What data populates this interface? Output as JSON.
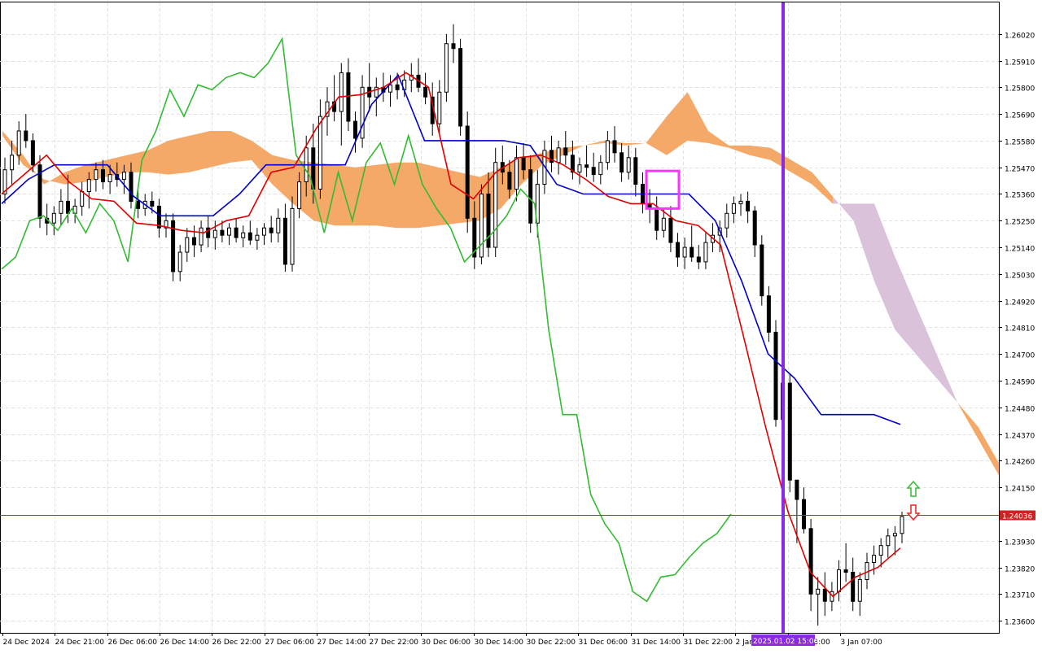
{
  "chart_data": {
    "type": "candlestick",
    "indicator": "Ichimoku Kinko Hyo",
    "grid": true,
    "ylim": [
      1.2355,
      1.2615
    ],
    "price_ticks": [
      "1.26020",
      "1.25910",
      "1.25800",
      "1.25690",
      "1.25580",
      "1.25470",
      "1.25360",
      "1.25250",
      "1.25140",
      "1.25030",
      "1.24920",
      "1.24810",
      "1.24700",
      "1.24590",
      "1.24480",
      "1.24370",
      "1.24260",
      "1.24150",
      "1.23930",
      "1.23820",
      "1.23710",
      "1.23600"
    ],
    "current_price": "1.24036",
    "current_price_value": 1.24036,
    "time_labels": [
      "24 Dec 2024",
      "24 Dec 21:00",
      "26 Dec 06:00",
      "26 Dec 14:00",
      "26 Dec 22:00",
      "27 Dec 06:00",
      "27 Dec 14:00",
      "27 Dec 22:00",
      "30 Dec 06:00",
      "30 Dec 14:00",
      "30 Dec 22:00",
      "31 Dec 06:00",
      "31 Dec 14:00",
      "31 Dec 22:00",
      "2 Jan",
      "2 Jan 23:00",
      "3 Jan 07:00"
    ],
    "highlight_time_label": "2025.01.02 15:00",
    "candles": [
      [
        1.2536,
        1.2551,
        1.2532,
        1.2546
      ],
      [
        1.2546,
        1.2558,
        1.254,
        1.2552
      ],
      [
        1.2552,
        1.2566,
        1.2548,
        1.2562
      ],
      [
        1.2562,
        1.2569,
        1.2555,
        1.2558
      ],
      [
        1.2558,
        1.2561,
        1.2545,
        1.2548
      ],
      [
        1.2548,
        1.2552,
        1.2522,
        1.2526
      ],
      [
        1.2526,
        1.2532,
        1.2519,
        1.2524
      ],
      [
        1.2524,
        1.2531,
        1.2519,
        1.2528
      ],
      [
        1.2528,
        1.2538,
        1.2523,
        1.2533
      ],
      [
        1.2533,
        1.2544,
        1.2524,
        1.2528
      ],
      [
        1.2528,
        1.2534,
        1.2524,
        1.2531
      ],
      [
        1.2531,
        1.2541,
        1.2527,
        1.2537
      ],
      [
        1.2537,
        1.2545,
        1.253,
        1.2542
      ],
      [
        1.2542,
        1.2549,
        1.2537,
        1.2546
      ],
      [
        1.2546,
        1.255,
        1.2538,
        1.2541
      ],
      [
        1.2541,
        1.2548,
        1.2536,
        1.2544
      ],
      [
        1.2544,
        1.2549,
        1.2539,
        1.2542
      ],
      [
        1.2542,
        1.2548,
        1.2536,
        1.2545
      ],
      [
        1.2545,
        1.2549,
        1.253,
        1.2533
      ],
      [
        1.2533,
        1.2538,
        1.2526,
        1.253
      ],
      [
        1.253,
        1.2536,
        1.2527,
        1.2533
      ],
      [
        1.2533,
        1.2537,
        1.2528,
        1.2531
      ],
      [
        1.2531,
        1.2534,
        1.2518,
        1.2522
      ],
      [
        1.2522,
        1.2528,
        1.2518,
        1.2525
      ],
      [
        1.2525,
        1.2528,
        1.25,
        1.2504
      ],
      [
        1.2504,
        1.2515,
        1.25,
        1.2512
      ],
      [
        1.2512,
        1.2522,
        1.2508,
        1.2518
      ],
      [
        1.2518,
        1.2523,
        1.251,
        1.2515
      ],
      [
        1.2515,
        1.2525,
        1.2512,
        1.2522
      ],
      [
        1.2522,
        1.2527,
        1.2514,
        1.2518
      ],
      [
        1.2518,
        1.2525,
        1.2513,
        1.2521
      ],
      [
        1.2521,
        1.2525,
        1.2516,
        1.2519
      ],
      [
        1.2519,
        1.2524,
        1.2515,
        1.2522
      ],
      [
        1.2522,
        1.2526,
        1.2516,
        1.2518
      ],
      [
        1.2518,
        1.2523,
        1.2514,
        1.252
      ],
      [
        1.252,
        1.2525,
        1.2515,
        1.2517
      ],
      [
        1.2517,
        1.2522,
        1.2513,
        1.2519
      ],
      [
        1.2519,
        1.2524,
        1.2515,
        1.2522
      ],
      [
        1.2522,
        1.2527,
        1.2516,
        1.252
      ],
      [
        1.252,
        1.253,
        1.2516,
        1.2526
      ],
      [
        1.2526,
        1.2532,
        1.2504,
        1.2507
      ],
      [
        1.2507,
        1.2535,
        1.2504,
        1.253
      ],
      [
        1.253,
        1.2545,
        1.2526,
        1.2541
      ],
      [
        1.2541,
        1.256,
        1.2535,
        1.2555
      ],
      [
        1.2555,
        1.2565,
        1.2532,
        1.2538
      ],
      [
        1.2538,
        1.2575,
        1.2534,
        1.2568
      ],
      [
        1.2568,
        1.258,
        1.256,
        1.2574
      ],
      [
        1.2574,
        1.2585,
        1.2566,
        1.257
      ],
      [
        1.257,
        1.259,
        1.2556,
        1.2586
      ],
      [
        1.2586,
        1.2592,
        1.2562,
        1.2566
      ],
      [
        1.2566,
        1.257,
        1.2553,
        1.2559
      ],
      [
        1.2559,
        1.2585,
        1.2555,
        1.258
      ],
      [
        1.258,
        1.259,
        1.257,
        1.2576
      ],
      [
        1.2576,
        1.2584,
        1.2568,
        1.258
      ],
      [
        1.258,
        1.2586,
        1.2574,
        1.2578
      ],
      [
        1.2578,
        1.2585,
        1.2572,
        1.2581
      ],
      [
        1.2581,
        1.2586,
        1.2575,
        1.2579
      ],
      [
        1.2579,
        1.2587,
        1.2576,
        1.2583
      ],
      [
        1.2583,
        1.259,
        1.2578,
        1.2585
      ],
      [
        1.2585,
        1.2592,
        1.2578,
        1.258
      ],
      [
        1.258,
        1.2586,
        1.2573,
        1.2576
      ],
      [
        1.2576,
        1.2582,
        1.256,
        1.2565
      ],
      [
        1.2565,
        1.2583,
        1.2561,
        1.2578
      ],
      [
        1.2578,
        1.2602,
        1.2574,
        1.2598
      ],
      [
        1.2598,
        1.2606,
        1.259,
        1.2596
      ],
      [
        1.2596,
        1.26,
        1.256,
        1.2564
      ],
      [
        1.2564,
        1.257,
        1.252,
        1.2526
      ],
      [
        1.2526,
        1.2533,
        1.2505,
        1.251
      ],
      [
        1.251,
        1.254,
        1.2507,
        1.2536
      ],
      [
        1.2536,
        1.2545,
        1.251,
        1.2514
      ],
      [
        1.2514,
        1.2555,
        1.251,
        1.2549
      ],
      [
        1.2549,
        1.2556,
        1.254,
        1.2545
      ],
      [
        1.2545,
        1.255,
        1.2534,
        1.2538
      ],
      [
        1.2538,
        1.2556,
        1.2533,
        1.2551
      ],
      [
        1.2551,
        1.2557,
        1.2542,
        1.2546
      ],
      [
        1.2546,
        1.2552,
        1.252,
        1.2524
      ],
      [
        1.2524,
        1.2546,
        1.2518,
        1.254
      ],
      [
        1.254,
        1.2558,
        1.2536,
        1.2554
      ],
      [
        1.2554,
        1.256,
        1.2545,
        1.2549
      ],
      [
        1.2549,
        1.2558,
        1.2544,
        1.2555
      ],
      [
        1.2555,
        1.2562,
        1.2548,
        1.2552
      ],
      [
        1.2552,
        1.2558,
        1.2542,
        1.2545
      ],
      [
        1.2545,
        1.2551,
        1.254,
        1.2548
      ],
      [
        1.2548,
        1.2556,
        1.2543,
        1.2547
      ],
      [
        1.2547,
        1.2553,
        1.2541,
        1.2544
      ],
      [
        1.2544,
        1.2552,
        1.254,
        1.2549
      ],
      [
        1.2549,
        1.2562,
        1.2546,
        1.2558
      ],
      [
        1.2558,
        1.2564,
        1.2549,
        1.2553
      ],
      [
        1.2553,
        1.2557,
        1.2541,
        1.2545
      ],
      [
        1.2545,
        1.2556,
        1.2542,
        1.2551
      ],
      [
        1.2551,
        1.2555,
        1.2535,
        1.254
      ],
      [
        1.254,
        1.2545,
        1.2528,
        1.2532
      ],
      [
        1.2532,
        1.2538,
        1.2524,
        1.253
      ],
      [
        1.253,
        1.2535,
        1.2517,
        1.2521
      ],
      [
        1.2521,
        1.253,
        1.2518,
        1.2526
      ],
      [
        1.2526,
        1.2531,
        1.2512,
        1.2516
      ],
      [
        1.2516,
        1.252,
        1.2506,
        1.251
      ],
      [
        1.251,
        1.2518,
        1.2505,
        1.2514
      ],
      [
        1.2514,
        1.2523,
        1.2508,
        1.251
      ],
      [
        1.251,
        1.2515,
        1.2505,
        1.2508
      ],
      [
        1.2508,
        1.252,
        1.2505,
        1.2516
      ],
      [
        1.2516,
        1.2524,
        1.2512,
        1.2519
      ],
      [
        1.2519,
        1.2525,
        1.2512,
        1.2522
      ],
      [
        1.2522,
        1.2532,
        1.2518,
        1.2528
      ],
      [
        1.2528,
        1.2535,
        1.2524,
        1.2532
      ],
      [
        1.2532,
        1.2536,
        1.2527,
        1.2533
      ],
      [
        1.2533,
        1.2537,
        1.2524,
        1.2529
      ],
      [
        1.2529,
        1.2531,
        1.251,
        1.2515
      ],
      [
        1.2515,
        1.2519,
        1.249,
        1.2494
      ],
      [
        1.2494,
        1.2498,
        1.2475,
        1.2479
      ],
      [
        1.2479,
        1.2484,
        1.244,
        1.2443
      ],
      [
        1.2443,
        1.2462,
        1.2436,
        1.2458
      ],
      [
        1.2458,
        1.2462,
        1.2413,
        1.2418
      ],
      [
        1.2418,
        1.2412,
        1.2392,
        1.241
      ],
      [
        1.241,
        1.2415,
        1.2396,
        1.2398
      ],
      [
        1.2398,
        1.2402,
        1.2364,
        1.2371
      ],
      [
        1.2371,
        1.2378,
        1.2358,
        1.2373
      ],
      [
        1.2373,
        1.238,
        1.2362,
        1.2368
      ],
      [
        1.2368,
        1.2376,
        1.2364,
        1.2372
      ],
      [
        1.2372,
        1.2385,
        1.2368,
        1.2381
      ],
      [
        1.2381,
        1.2392,
        1.2376,
        1.238
      ],
      [
        1.238,
        1.2386,
        1.2364,
        1.2368
      ],
      [
        1.2368,
        1.238,
        1.2362,
        1.2377
      ],
      [
        1.2377,
        1.2388,
        1.2373,
        1.2384
      ],
      [
        1.2384,
        1.2391,
        1.2379,
        1.2387
      ],
      [
        1.2387,
        1.2394,
        1.2382,
        1.2391
      ],
      [
        1.2391,
        1.2398,
        1.2386,
        1.2395
      ],
      [
        1.2395,
        1.2399,
        1.2387,
        1.2396
      ],
      [
        1.2396,
        1.2405,
        1.2392,
        1.2403
      ]
    ],
    "tenkan_sen": [
      [
        1.2536,
        1.2544
      ],
      [
        1.2546,
        1.2552
      ],
      [
        1.2552,
        1.2541
      ],
      [
        1.2541,
        1.2534
      ],
      [
        1.2534,
        1.2533
      ],
      [
        1.2533,
        1.2524
      ],
      [
        1.2524,
        1.2523
      ],
      [
        1.2523,
        1.2521
      ],
      [
        1.2521,
        1.252
      ],
      [
        1.252,
        1.2525
      ],
      [
        1.2525,
        1.2527
      ],
      [
        1.2527,
        1.2545
      ],
      [
        1.2545,
        1.2547
      ],
      [
        1.2547,
        1.2563
      ],
      [
        1.2563,
        1.2576
      ],
      [
        1.2576,
        1.2577
      ],
      [
        1.2577,
        1.258
      ],
      [
        1.258,
        1.2586
      ],
      [
        1.2586,
        1.258
      ],
      [
        1.258,
        1.254
      ],
      [
        1.254,
        1.2534
      ],
      [
        1.2534,
        1.2545
      ],
      [
        1.2545,
        1.2551
      ],
      [
        1.2551,
        1.2552
      ],
      [
        1.2552,
        1.2548
      ],
      [
        1.2548,
        1.2542
      ],
      [
        1.2542,
        1.2535
      ],
      [
        1.2535,
        1.2532
      ],
      [
        1.2532,
        1.2532
      ],
      [
        1.2532,
        1.2525
      ],
      [
        1.2525,
        1.2523
      ],
      [
        1.2523,
        1.2515
      ],
      [
        1.2515,
        1.2478
      ],
      [
        1.2478,
        1.244
      ],
      [
        1.244,
        1.2405
      ],
      [
        1.2405,
        1.238
      ],
      [
        1.238,
        1.237
      ],
      [
        1.237,
        1.2378
      ],
      [
        1.2378,
        1.2382
      ],
      [
        1.2382,
        1.239
      ]
    ],
    "kijun_sen": [
      [
        1.2532,
        1.2542
      ],
      [
        1.2542,
        1.2548
      ],
      [
        1.2548,
        1.2548
      ],
      [
        1.2548,
        1.2548
      ],
      [
        1.2548,
        1.2535
      ],
      [
        1.2535,
        1.2527
      ],
      [
        1.2527,
        1.2527
      ],
      [
        1.2527,
        1.2527
      ],
      [
        1.2527,
        1.2536
      ],
      [
        1.2536,
        1.2548
      ],
      [
        1.2548,
        1.2548
      ],
      [
        1.2548,
        1.2548
      ],
      [
        1.2548,
        1.2548
      ],
      [
        1.2548,
        1.2573
      ],
      [
        1.2573,
        1.2585
      ],
      [
        1.2585,
        1.2558
      ],
      [
        1.2558,
        1.2558
      ],
      [
        1.2558,
        1.2558
      ],
      [
        1.2558,
        1.2558
      ],
      [
        1.2558,
        1.2556
      ],
      [
        1.2556,
        1.254
      ],
      [
        1.254,
        1.2536
      ],
      [
        1.2536,
        1.2536
      ],
      [
        1.2536,
        1.2536
      ],
      [
        1.2536,
        1.2536
      ],
      [
        1.2536,
        1.2536
      ],
      [
        1.2536,
        1.2525
      ],
      [
        1.2525,
        1.25
      ],
      [
        1.25,
        1.247
      ],
      [
        1.247,
        1.246
      ],
      [
        1.246,
        1.2445
      ],
      [
        1.2445,
        1.2445
      ],
      [
        1.2445,
        1.2445
      ],
      [
        1.2445,
        1.2441
      ]
    ],
    "chikou_span": [
      [
        1.2505,
        1.251
      ],
      [
        1.251,
        1.2525
      ],
      [
        1.2525,
        1.2527
      ],
      [
        1.2527,
        1.2521
      ],
      [
        1.2521,
        1.253
      ],
      [
        1.253,
        1.252
      ],
      [
        1.252,
        1.2532
      ],
      [
        1.2532,
        1.2525
      ],
      [
        1.2525,
        1.2508
      ],
      [
        1.2508,
        1.255
      ],
      [
        1.255,
        1.2562
      ],
      [
        1.2562,
        1.2579
      ],
      [
        1.2579,
        1.2568
      ],
      [
        1.2568,
        1.2581
      ],
      [
        1.2581,
        1.2579
      ],
      [
        1.2579,
        1.2584
      ],
      [
        1.2584,
        1.2586
      ],
      [
        1.2586,
        1.2584
      ],
      [
        1.2584,
        1.259
      ],
      [
        1.259,
        1.26
      ],
      [
        1.26,
        1.2552
      ],
      [
        1.2552,
        1.2543
      ],
      [
        1.2543,
        1.252
      ],
      [
        1.252,
        1.2545
      ],
      [
        1.2545,
        1.2525
      ],
      [
        1.2525,
        1.2549
      ],
      [
        1.2549,
        1.2557
      ],
      [
        1.2557,
        1.254
      ],
      [
        1.254,
        1.256
      ],
      [
        1.256,
        1.254
      ],
      [
        1.254,
        1.253
      ],
      [
        1.253,
        1.2522
      ],
      [
        1.2522,
        1.2508
      ],
      [
        1.2508,
        1.2514
      ],
      [
        1.2514,
        1.252
      ],
      [
        1.252,
        1.2527
      ],
      [
        1.2527,
        1.2538
      ],
      [
        1.2538,
        1.2532
      ],
      [
        1.2532,
        1.248
      ],
      [
        1.248,
        1.2445
      ],
      [
        1.2445,
        1.2445
      ],
      [
        1.2445,
        1.2412
      ],
      [
        1.2412,
        1.24
      ],
      [
        1.24,
        1.2392
      ],
      [
        1.2392,
        1.2372
      ],
      [
        1.2372,
        1.2368
      ],
      [
        1.2368,
        1.2378
      ],
      [
        1.2378,
        1.2379
      ],
      [
        1.2379,
        1.2386
      ],
      [
        1.2386,
        1.2392
      ],
      [
        1.2392,
        1.2396
      ],
      [
        1.2396,
        1.2404
      ]
    ],
    "kumo": {
      "senkou_span_a": [
        1.2562,
        1.2552,
        1.254,
        1.2545,
        1.2548,
        1.255,
        1.2552,
        1.2554,
        1.2558,
        1.256,
        1.2562,
        1.2562,
        1.2558,
        1.2552,
        1.255,
        1.2549,
        1.2548,
        1.2547,
        1.2548,
        1.2549,
        1.2549,
        1.2547,
        1.2545,
        1.2543,
        1.2547,
        1.2551,
        1.2553,
        1.2555,
        1.2556,
        1.2558,
        1.2557,
        1.2557,
        1.2568,
        1.2578,
        1.2562,
        1.2556,
        1.2556,
        1.2555,
        1.255,
        1.2545,
        1.2535,
        1.2525,
        1.25,
        1.248,
        1.247,
        1.246,
        1.245,
        1.244,
        1.2425
      ],
      "senkou_span_b": [
        1.256,
        1.2548,
        1.2542,
        1.254,
        1.2541,
        1.2543,
        1.2545,
        1.2545,
        1.2544,
        1.2545,
        1.2547,
        1.2549,
        1.255,
        1.254,
        1.2532,
        1.2525,
        1.2523,
        1.2523,
        1.2523,
        1.2522,
        1.2522,
        1.2523,
        1.2524,
        1.2525,
        1.253,
        1.254,
        1.2548,
        1.2552,
        1.2556,
        1.2557,
        1.2556,
        1.2557,
        1.2552,
        1.2558,
        1.2557,
        1.2555,
        1.2552,
        1.255,
        1.2545,
        1.254,
        1.2532,
        1.2532,
        1.2532,
        1.251,
        1.249,
        1.247,
        1.245,
        1.2435,
        1.242
      ]
    },
    "markers": {
      "up_arrow": "buy",
      "down_arrow": "sell"
    },
    "colors": {
      "tenkan": "#e00000",
      "kijun": "#0000cc",
      "chikou": "#33bb33",
      "kumo_bull": "#f4a460",
      "kumo_bear": "#d8bfd8",
      "vline": "#8a2be2",
      "box": "#ff33ff",
      "price_line": "#cc2222",
      "up_arrow": "#33bb33",
      "down_arrow": "#ee2222"
    }
  }
}
